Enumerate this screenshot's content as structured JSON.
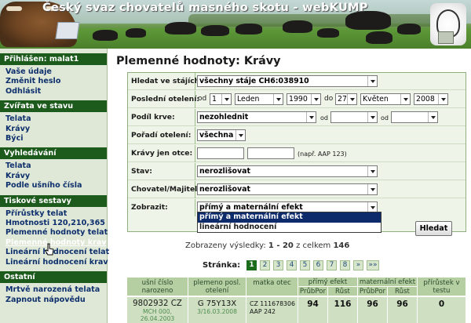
{
  "banner": {
    "title": "Český svaz chovatelů masného skotu - webKUMP"
  },
  "sidebar": {
    "login": "Přihlášen: malat1",
    "account_items": [
      "Vaše údaje",
      "Změnit heslo",
      "Odhlásit"
    ],
    "sections": [
      {
        "title": "Zvířata ve stavu",
        "items": [
          "Telata",
          "Krávy",
          "Býci"
        ]
      },
      {
        "title": "Vyhledávání",
        "items": [
          "Telata",
          "Krávy",
          "Podle ušního čísla"
        ]
      },
      {
        "title": "Tiskové sestavy",
        "items": [
          "Přírůstky telat",
          "Hmotnosti 120,210,365",
          "Plemenné hodnoty telat",
          "Plemenné hodnoty krav",
          "Lineární hodnocení telat",
          "Lineární hodnocení krav"
        ]
      },
      {
        "title": "Ostatní",
        "items": [
          "Mrtvě narozená telata",
          "Zapnout nápovědu"
        ]
      }
    ],
    "active_item": "Plemenné hodnoty krav"
  },
  "page": {
    "title": "Plemenné hodnoty: Krávy"
  },
  "form": {
    "labels": {
      "staje": "Hledat ve stájích:",
      "otelen": "Poslední otelení:",
      "krev": "Podíl krve:",
      "poradi": "Pořadí otelení:",
      "otec": "Krávy jen otce:",
      "stav": "Stav:",
      "chovatel": "Chovatel/Majitel:",
      "zobrazit": "Zobrazit:"
    },
    "staje_value": "všechny stáje CH6:038910",
    "od_label": "od",
    "do_label": "do",
    "od_day": "1",
    "od_month": "Leden",
    "od_year": "1990",
    "do_day": "27",
    "do_month": "Květen",
    "do_year": "2008",
    "krev_value": "nezohlednit",
    "krev_od1": "od",
    "krev_od2": "od",
    "poradi_value": "všechna",
    "otec_hint": "(např. AAP 123)",
    "stav_value": "nerozlišovat",
    "chovatel_value": "nerozlišovat",
    "zobrazit_value": "přímý a maternální efekt",
    "zobrazit_options": [
      "přímý a maternální efekt",
      "lineární hodnocení"
    ],
    "submit_label": "Hledat"
  },
  "results": {
    "prefix": "Zobrazeny výsledky:",
    "range": "1 - 20",
    "middle": "z celkem",
    "total": "146"
  },
  "pager": {
    "label": "Stránka:",
    "pages": [
      "1",
      "2",
      "3",
      "4",
      "5",
      "6",
      "7",
      "8",
      "»",
      "»»"
    ],
    "current": "1"
  },
  "table": {
    "headers": {
      "usni": "ušní číslo narozeno",
      "plemeno": "plemeno posl. otelení",
      "matka": "matka otec",
      "primy": "přímý efekt",
      "maternalni": "maternální efekt",
      "prirustek": "přírůstek v testu",
      "prubpor": "PrůbPor",
      "rust": "Růst"
    },
    "row": {
      "usni": "9802932 CZ",
      "narozeno": "MCH 000, 26.04.2003",
      "plemeno": "G 75Y13X",
      "otelen": "3/16.03.2008",
      "matka": "CZ 111678306",
      "otec": "AAP 242",
      "primy_prubpor": "94",
      "primy_rust": "116",
      "mat_prubpor": "96",
      "mat_rust": "96",
      "prirustek": "0"
    }
  }
}
